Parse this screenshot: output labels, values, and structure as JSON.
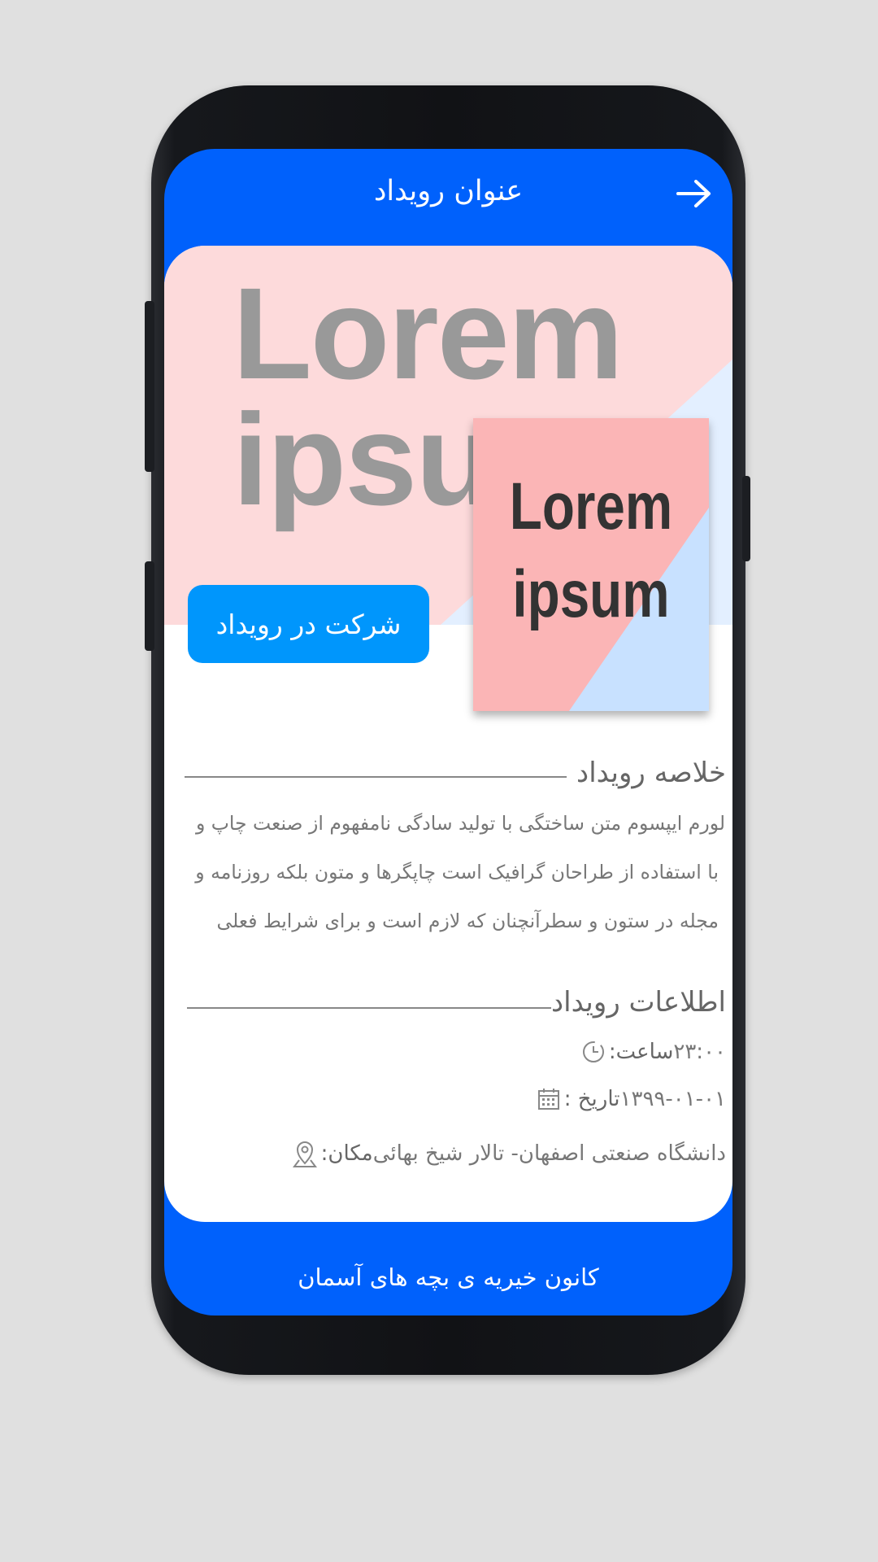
{
  "header": {
    "title": "عنوان رویداد"
  },
  "banner": {
    "big_line1": "Lorem",
    "big_line2": "ipsum",
    "poster_line1": "Lorem",
    "poster_line2": "ipsum",
    "join_label": "شرکت در رویداد"
  },
  "summary": {
    "title": "خلاصه رویداد",
    "line1": "لورم ایپسوم متن ساختگی با تولید سادگی نامفهوم از صنعت چاپ و",
    "line2": "با استفاده از طراحان گرافیک است چاپگرها و متون بلکه روزنامه و",
    "line3": "مجله در ستون و سطرآنچنان که لازم است و برای شرایط فعلی"
  },
  "info": {
    "title": "اطلاعات رویداد",
    "time_label": "ساعت:",
    "time_value": "۲۳:۰۰",
    "date_label": "تاریخ :",
    "date_value": "۱۳۹۹-۰۱-۰۱",
    "place_label": "مکان:",
    "place_value": "دانشگاه صنعتی اصفهان- تالار شیخ بهائی"
  },
  "footer": {
    "text": "کانون خیریه ی بچه های آسمان"
  },
  "colors": {
    "primary": "#0061fc",
    "button": "#0096fc",
    "poster_pink": "#fbb5b6",
    "poster_blue": "#c8e1ff"
  },
  "icons": [
    "arrow-right-icon",
    "clock-icon",
    "calendar-icon",
    "location-pin-icon"
  ]
}
